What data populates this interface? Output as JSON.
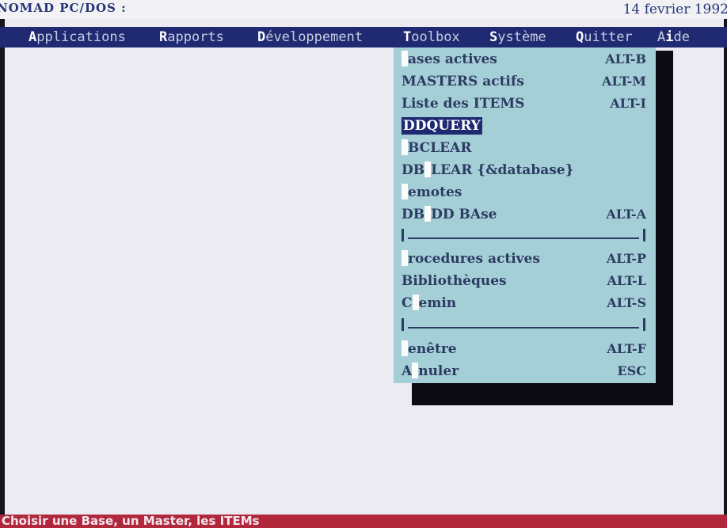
{
  "title_bar": {
    "left": "NOMAD PC/DOS :",
    "date": "14 fevrier 1992"
  },
  "menubar": {
    "items": [
      {
        "hotkey": "A",
        "rest": "pplications"
      },
      {
        "hotkey": "R",
        "rest": "apports"
      },
      {
        "hotkey": "D",
        "rest": "éveloppement"
      },
      {
        "hotkey": "T",
        "rest": "oolbox"
      },
      {
        "hotkey": "S",
        "rest": "ystème"
      },
      {
        "hotkey": "Q",
        "rest": "uitter"
      },
      {
        "hotkey": "",
        "rest": "A",
        "hotkey2": "i",
        "rest2": "de"
      }
    ]
  },
  "dropdown": {
    "items": [
      {
        "label": "ases actives",
        "shortcut": "ALT-B",
        "hk": true
      },
      {
        "label": "MASTERS actifs",
        "shortcut": "ALT-M",
        "hk": false
      },
      {
        "label": "Liste des ITEMS",
        "shortcut": "ALT-I",
        "hk": false
      },
      {
        "label": "DDQUERY",
        "shortcut": "",
        "hk": false,
        "selected": true
      },
      {
        "label": "BCLEAR",
        "shortcut": "",
        "hk": true
      },
      {
        "label_a": "DB",
        "label_b": "LEAR {&database}",
        "shortcut": "",
        "hk_mid": true
      },
      {
        "label": "emotes",
        "shortcut": "",
        "hk": true
      },
      {
        "label_a": "DB",
        "label_b": "DD BAse",
        "shortcut": "ALT-A",
        "hk_mid": true
      },
      {
        "separator": true
      },
      {
        "label": "rocedures actives",
        "shortcut": "ALT-P",
        "hk": true
      },
      {
        "label": "Bibliothèques",
        "shortcut": "ALT-L",
        "hk": false
      },
      {
        "label_a": "C",
        "label_b": "emin",
        "shortcut": "ALT-S",
        "hk_mid": true
      },
      {
        "separator": true
      },
      {
        "label": "enêtre",
        "shortcut": "ALT-F",
        "hk": true
      },
      {
        "label_a": "A",
        "label_b": "nuler",
        "shortcut": "ESC",
        "hk_mid": true
      }
    ]
  },
  "status": {
    "text": "Choisir une Base, un Master, les ITEMs"
  },
  "colors": {
    "menubar_bg": "#1f2a73",
    "dropdown_bg": "#a5cfd6",
    "status_bg": "#b1283d",
    "screen_bg": "#ecebf1"
  }
}
